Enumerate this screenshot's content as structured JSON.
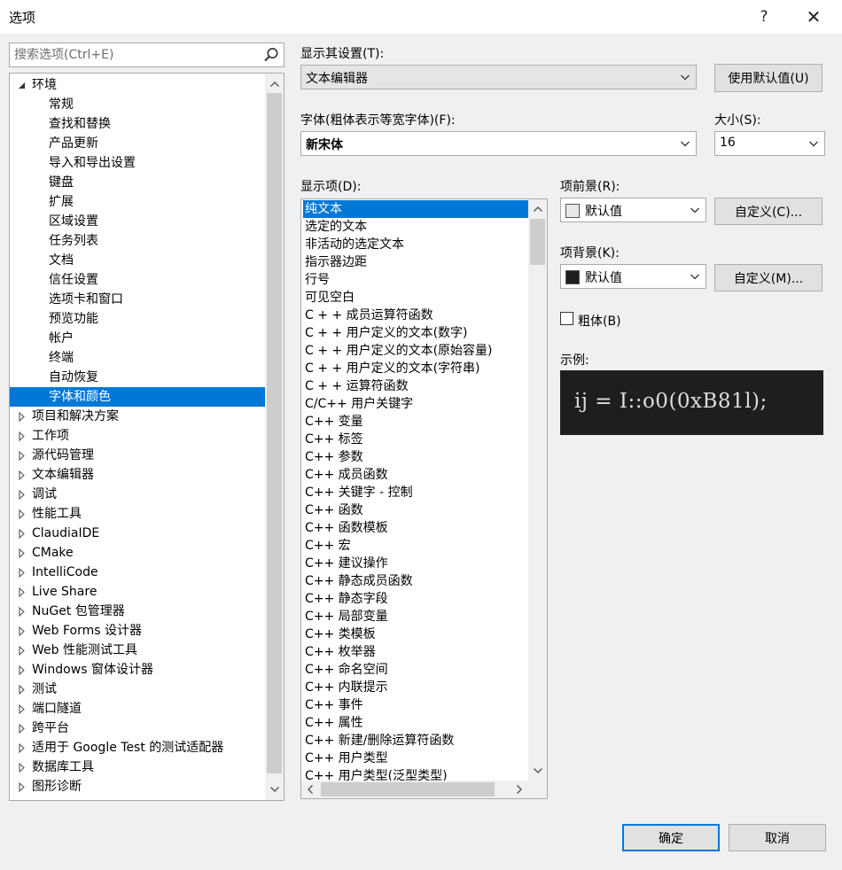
{
  "window": {
    "title": "选项",
    "help_glyph": "?",
    "close_glyph": "✕"
  },
  "search": {
    "placeholder": "搜索选项(Ctrl+E)",
    "value": ""
  },
  "tree": {
    "items": [
      {
        "label": "环境",
        "expanded": true,
        "has_children": true,
        "indent": 0
      },
      {
        "label": "常规",
        "indent": 1
      },
      {
        "label": "查找和替换",
        "indent": 1
      },
      {
        "label": "产品更新",
        "indent": 1
      },
      {
        "label": "导入和导出设置",
        "indent": 1
      },
      {
        "label": "键盘",
        "indent": 1
      },
      {
        "label": "扩展",
        "indent": 1
      },
      {
        "label": "区域设置",
        "indent": 1
      },
      {
        "label": "任务列表",
        "indent": 1
      },
      {
        "label": "文档",
        "indent": 1
      },
      {
        "label": "信任设置",
        "indent": 1
      },
      {
        "label": "选项卡和窗口",
        "indent": 1
      },
      {
        "label": "预览功能",
        "indent": 1
      },
      {
        "label": "帐户",
        "indent": 1
      },
      {
        "label": "终端",
        "indent": 1
      },
      {
        "label": "自动恢复",
        "indent": 1
      },
      {
        "label": "字体和颜色",
        "indent": 1,
        "selected": true
      },
      {
        "label": "项目和解决方案",
        "has_children": true,
        "indent": 0
      },
      {
        "label": "工作项",
        "has_children": true,
        "indent": 0
      },
      {
        "label": "源代码管理",
        "has_children": true,
        "indent": 0
      },
      {
        "label": "文本编辑器",
        "has_children": true,
        "indent": 0
      },
      {
        "label": "调试",
        "has_children": true,
        "indent": 0
      },
      {
        "label": "性能工具",
        "has_children": true,
        "indent": 0
      },
      {
        "label": "ClaudiaIDE",
        "has_children": true,
        "indent": 0
      },
      {
        "label": "CMake",
        "has_children": true,
        "indent": 0
      },
      {
        "label": "IntelliCode",
        "has_children": true,
        "indent": 0
      },
      {
        "label": "Live Share",
        "has_children": true,
        "indent": 0
      },
      {
        "label": "NuGet 包管理器",
        "has_children": true,
        "indent": 0
      },
      {
        "label": "Web Forms 设计器",
        "has_children": true,
        "indent": 0
      },
      {
        "label": "Web 性能测试工具",
        "has_children": true,
        "indent": 0
      },
      {
        "label": "Windows 窗体设计器",
        "has_children": true,
        "indent": 0
      },
      {
        "label": "测试",
        "has_children": true,
        "indent": 0
      },
      {
        "label": "端口隧道",
        "has_children": true,
        "indent": 0
      },
      {
        "label": "跨平台",
        "has_children": true,
        "indent": 0
      },
      {
        "label": "适用于 Google Test 的测试适配器",
        "has_children": true,
        "indent": 0
      },
      {
        "label": "数据库工具",
        "has_children": true,
        "indent": 0
      },
      {
        "label": "图形诊断",
        "has_children": true,
        "indent": 0
      }
    ]
  },
  "settings": {
    "show_settings_for_label": "显示其设置(T):",
    "show_settings_for_value": "文本编辑器",
    "use_defaults_button": "使用默认值(U)",
    "font_label": "字体(粗体表示等宽字体)(F):",
    "font_value": "新宋体",
    "size_label": "大小(S):",
    "size_value": "16",
    "display_items_label": "显示项(D):",
    "foreground_label": "项前景(R):",
    "foreground_value": "默认值",
    "foreground_color": "#e8e8e8",
    "foreground_custom_button": "自定义(C)...",
    "background_label": "项背景(K):",
    "background_value": "默认值",
    "background_color": "#1e1e1e",
    "background_custom_button": "自定义(M)...",
    "bold_label": "粗体(B)",
    "bold_checked": false,
    "sample_label": "示例:",
    "sample_text": "ij = I::o0(0xB81l);",
    "sample_bg": "#1e1e1e",
    "sample_fg": "#dcdcdc"
  },
  "display_items": [
    "纯文本",
    "选定的文本",
    "非活动的选定文本",
    "指示器边距",
    "行号",
    "可见空白",
    "C + + 成员运算符函数",
    "C + + 用户定义的文本(数字)",
    "C + + 用户定义的文本(原始容量)",
    "C + + 用户定义的文本(字符串)",
    "C + + 运算符函数",
    "C/C++ 用户关键字",
    "C++ 变量",
    "C++ 标签",
    "C++ 参数",
    "C++ 成员函数",
    "C++ 关键字 - 控制",
    "C++ 函数",
    "C++ 函数模板",
    "C++ 宏",
    "C++ 建议操作",
    "C++ 静态成员函数",
    "C++ 静态字段",
    "C++ 局部变量",
    "C++ 类模板",
    "C++ 枚举器",
    "C++ 命名空间",
    "C++ 内联提示",
    "C++ 事件",
    "C++ 属性",
    "C++ 新建/删除运算符函数",
    "C++ 用户类型",
    "C++ 用户类型(泛型类型)"
  ],
  "display_items_selected": 0,
  "footer": {
    "ok_button": "确定",
    "cancel_button": "取消"
  },
  "colors": {
    "accent": "#0078d7",
    "panel_bg": "#f0f0f0",
    "border": "#a9a9a9"
  }
}
